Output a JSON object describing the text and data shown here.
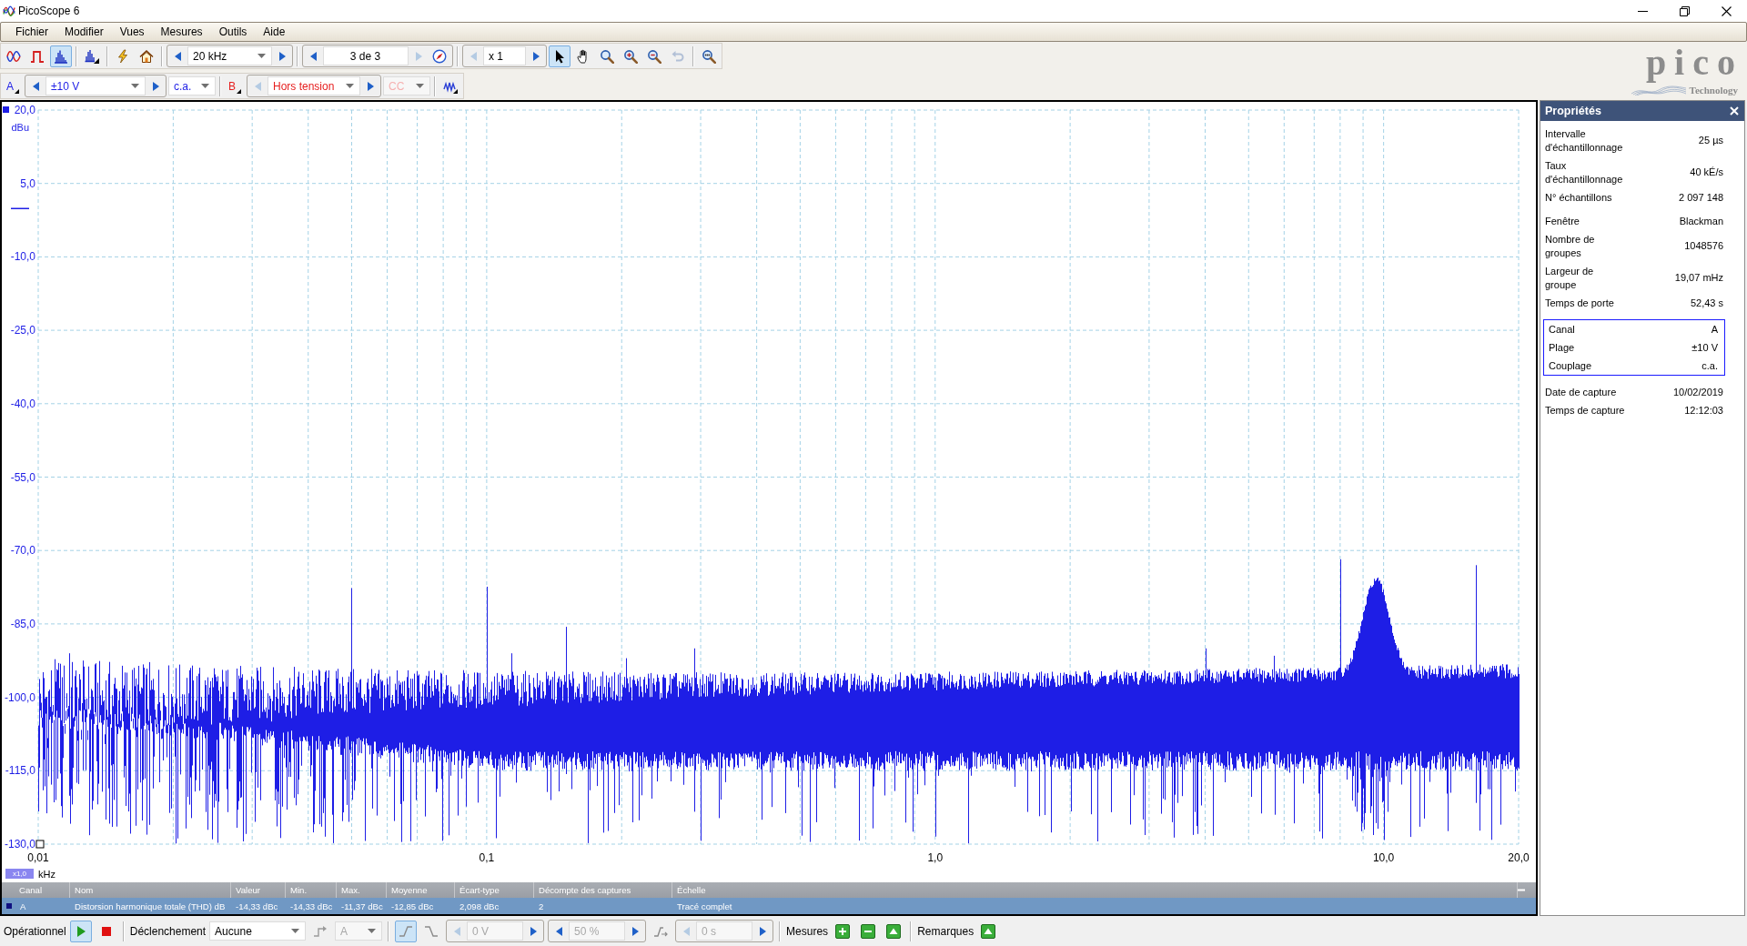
{
  "window": {
    "title": "PicoScope 6"
  },
  "menu": [
    "Fichier",
    "Modifier",
    "Vues",
    "Mesures",
    "Outils",
    "Aide"
  ],
  "toolbar": {
    "views": [
      {
        "kind": "scope",
        "selected": false
      },
      {
        "kind": "persistence",
        "selected": false
      },
      {
        "kind": "spectrum",
        "selected": true
      }
    ],
    "frequency_range": {
      "kind": "dropdown",
      "value": "20 kHz",
      "disabled": false,
      "prev_disabled": false,
      "next_disabled": false
    },
    "capture_index": {
      "kind": "field",
      "value": "3 de 3",
      "disabled": false,
      "prev_disabled": false,
      "next_disabled": true
    },
    "zoom_factor": {
      "kind": "field",
      "value": "x 1",
      "disabled": false,
      "prev_disabled": true,
      "next_disabled": false
    },
    "tools": [
      {
        "kind": "pointer",
        "selected": true,
        "disabled": false
      },
      {
        "kind": "hand",
        "selected": false,
        "disabled": false
      },
      {
        "kind": "zoom",
        "selected": false,
        "disabled": false
      },
      {
        "kind": "zoom-in",
        "selected": false,
        "disabled": false
      },
      {
        "kind": "zoom-out",
        "selected": false,
        "disabled": false
      },
      {
        "kind": "undo",
        "selected": false,
        "disabled": true
      },
      {
        "kind": "zoom-fit",
        "selected": false,
        "disabled": false
      }
    ]
  },
  "logo": {
    "name": "pico",
    "tagline": "Technology"
  },
  "channels": [
    {
      "label": "A",
      "color": "#1e1ee6",
      "range": {
        "kind": "dropdown",
        "value": "±10 V",
        "disabled": false,
        "prev_disabled": false,
        "next_disabled": false
      },
      "coupling": {
        "value": "c.a.",
        "disabled": false
      }
    },
    {
      "label": "B",
      "color": "#e61e1e",
      "range": {
        "kind": "dropdown",
        "value": "Hors tension",
        "disabled": false,
        "prev_disabled": true,
        "next_disabled": false
      },
      "coupling": {
        "value": "CC",
        "disabled": true
      }
    }
  ],
  "graph": {
    "y_ticks": [
      "20,0",
      "5,0",
      "-10,0",
      "-25,0",
      "-40,0",
      "-55,0",
      "-70,0",
      "-85,0",
      "-100,0",
      "-115,0",
      "-130,0"
    ],
    "y_unit": "dBu",
    "x_ticks": [
      "0,01",
      "0,1",
      "1,0",
      "10,0",
      "20,0"
    ],
    "x_scale": "x1,0",
    "x_unit": "kHz"
  },
  "measurements": {
    "columns": [
      "Canal",
      "Nom",
      "Valeur",
      "Min.",
      "Max.",
      "Moyenne",
      "Écart-type",
      "Décompte des captures",
      "Échelle"
    ],
    "rows": [
      {
        "color": "#101080",
        "selected": true,
        "cells": [
          "A",
          "Distorsion harmonique totale (THD) dB",
          "-14,33 dBc",
          "-14,33 dBc",
          "-11,37 dBc",
          "-12,85 dBc",
          "2,098 dBc",
          "2",
          "Tracé complet"
        ]
      }
    ]
  },
  "properties": {
    "title": "Propriétés",
    "groups": [
      {
        "boxed": false,
        "rows": [
          {
            "label": "Intervalle d'échantillonnage",
            "value": "25 µs"
          },
          {
            "label": "Taux d'échantillonnage",
            "value": "40 kÉ/s"
          },
          {
            "label": "N° échantillons",
            "value": "2 097 148"
          }
        ]
      },
      {
        "boxed": false,
        "rows": [
          {
            "label": "Fenêtre",
            "value": "Blackman"
          },
          {
            "label": "Nombre de groupes",
            "value": "1048576"
          },
          {
            "label": "Largeur de groupe",
            "value": "19,07 mHz"
          },
          {
            "label": "Temps de porte",
            "value": "52,43 s"
          }
        ]
      },
      {
        "boxed": true,
        "rows": [
          {
            "label": "Canal",
            "value": "A"
          },
          {
            "label": "Plage",
            "value": "±10 V"
          },
          {
            "label": "Couplage",
            "value": "c.a."
          }
        ]
      },
      {
        "boxed": false,
        "rows": [
          {
            "label": "Date de capture",
            "value": "10/02/2019"
          },
          {
            "label": "Temps de capture",
            "value": "12:12:03"
          }
        ]
      }
    ]
  },
  "status_bar": {
    "run_label": "Opérationnel",
    "run_buttons": [
      {
        "kind": "play",
        "selected": true
      },
      {
        "kind": "stop",
        "selected": false
      }
    ],
    "trigger_label": "Déclenchement",
    "trigger_mode": {
      "value": "Aucune",
      "disabled": false
    },
    "trigger_source": {
      "value": "A",
      "disabled": true
    },
    "edges": [
      {
        "kind": "rising",
        "selected": true
      },
      {
        "kind": "falling",
        "selected": false
      }
    ],
    "threshold": {
      "kind": "field",
      "value": "0 V",
      "disabled": true,
      "prev_disabled": true,
      "next_disabled": false
    },
    "pre_trigger": {
      "kind": "field",
      "value": "50 %",
      "disabled": true,
      "prev_disabled": false,
      "next_disabled": false
    },
    "delay": {
      "kind": "field",
      "value": "0 s",
      "disabled": true,
      "prev_disabled": true,
      "next_disabled": false
    },
    "measures_label": "Mesures",
    "notes_label": "Remarques"
  }
}
